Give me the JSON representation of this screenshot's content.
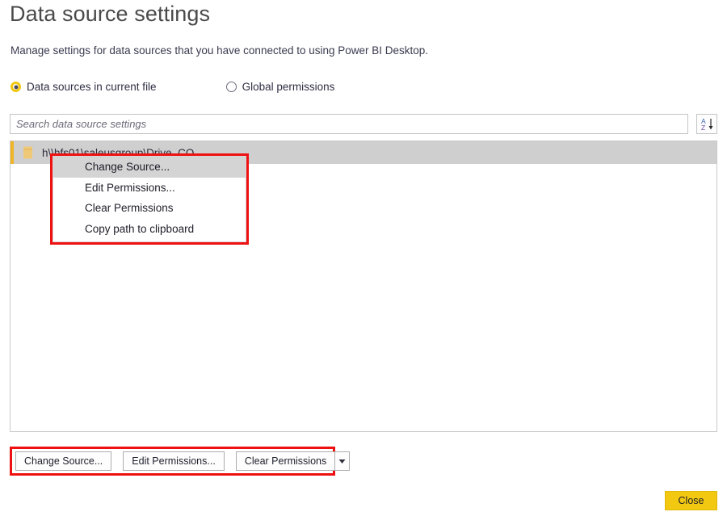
{
  "dialog": {
    "title": "Data source settings",
    "subtitle": "Manage settings for data sources that you have connected to using Power BI Desktop.",
    "close_label": "Close"
  },
  "scope_options": [
    {
      "label": "Data sources in current file",
      "selected": true
    },
    {
      "label": "Global permissions",
      "selected": false
    }
  ],
  "search": {
    "placeholder": "Search data source settings",
    "value": "",
    "sort_icon": "sort-az-icon",
    "sort_letters_top": "A",
    "sort_letters_bottom": "Z"
  },
  "data_sources": [
    {
      "label": "h\\\\hfs01\\saleusgroup\\Drive_CO",
      "icon": "database-folder-icon",
      "selected": true
    }
  ],
  "context_menu": {
    "items": [
      {
        "label": "Change Source...",
        "highlighted": true
      },
      {
        "label": "Edit Permissions...",
        "highlighted": false
      },
      {
        "label": "Clear Permissions",
        "highlighted": false
      },
      {
        "label": "Copy path to clipboard",
        "highlighted": false
      }
    ]
  },
  "action_bar": {
    "change_source": "Change Source...",
    "edit_permissions": "Edit Permissions...",
    "clear_permissions": "Clear Permissions",
    "dropdown_icon": "chevron-down-icon"
  },
  "colors": {
    "accent_yellow": "#f2c811",
    "highlight_red": "#ee1111",
    "row_selected_gray": "#cfcfcf",
    "row_accent": "#f0b429"
  }
}
